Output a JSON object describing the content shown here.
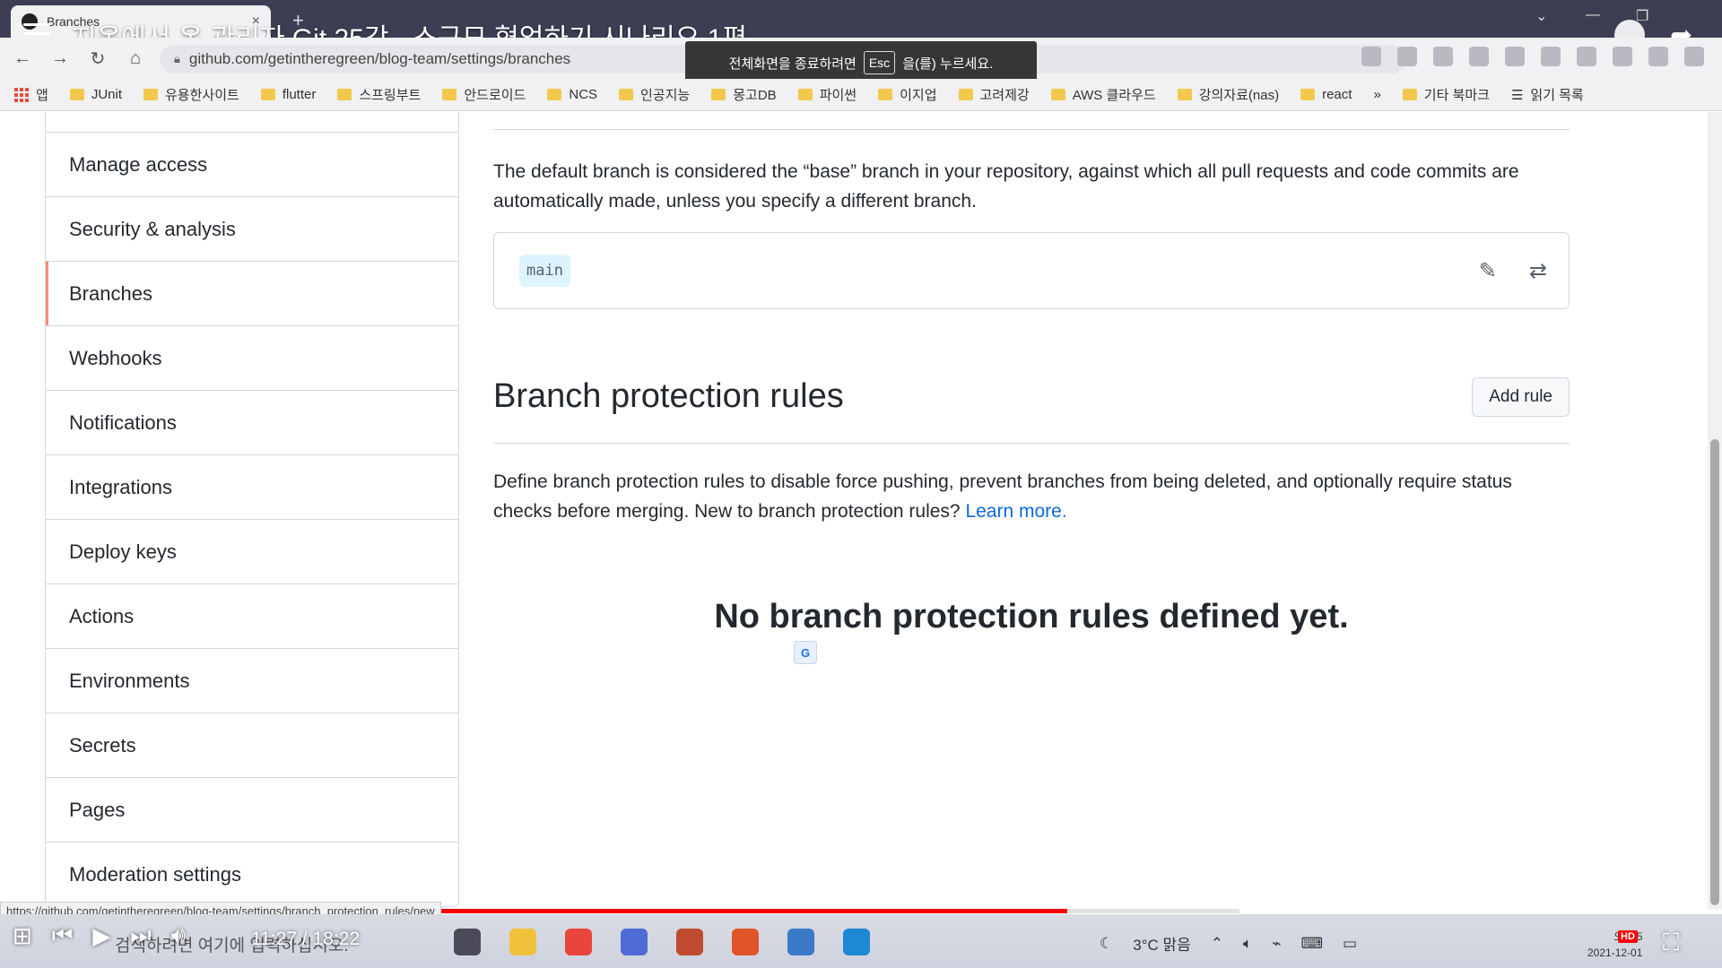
{
  "browser": {
    "tab_title": "Branches",
    "tab_close": "×",
    "new_tab": "+",
    "url": "github.com/getintheregreen/blog-team/settings/branches",
    "bookmarks": [
      "앱",
      "JUnit",
      "유용한사이트",
      "flutter",
      "스프링부트",
      "안드로이드",
      "NCS",
      "인공지능",
      "몽고DB",
      "파이썬",
      "이지업",
      "고려제강",
      "AWS 클라우드",
      "강의자료(nas)",
      "react"
    ],
    "bookmarks_more": "»",
    "other_bookmarks": "기타 북마크",
    "reading_list": "읽기 목록"
  },
  "video": {
    "title": "지옥에서 온 관리자 Git 25강 - 소규모 협업하기 시나리오 1편",
    "fullscreen_hint_pre": "전체화면을 종료하려면",
    "fullscreen_hint_key": "Esc",
    "fullscreen_hint_post": "을(를) 누르세요.",
    "time": "11:27 / 18:22",
    "progress_played": 0.62,
    "progress_loaded": 0.72,
    "hover_url": "https://github.com/getintheregreen/blog-team/settings/branch_protection_rules/new",
    "hd_badge": "HD"
  },
  "sidebar": {
    "items": [
      {
        "label": "Manage access"
      },
      {
        "label": "Security & analysis"
      },
      {
        "label": "Branches"
      },
      {
        "label": "Webhooks"
      },
      {
        "label": "Notifications"
      },
      {
        "label": "Integrations"
      },
      {
        "label": "Deploy keys"
      },
      {
        "label": "Actions"
      },
      {
        "label": "Environments"
      },
      {
        "label": "Secrets"
      },
      {
        "label": "Pages"
      },
      {
        "label": "Moderation settings"
      }
    ]
  },
  "default_branch": {
    "description": "The default branch is considered the “base” branch in your repository, against which all pull requests and code commits are automatically made, unless you specify a different branch.",
    "branch_name": "main"
  },
  "protection": {
    "title": "Branch protection rules",
    "add_rule_label": "Add rule",
    "description": "Define branch protection rules to disable force pushing, prevent branches from being deleted, and optionally require status checks before merging. New to branch protection rules?",
    "learn_more": "Learn more.",
    "empty_message": "No branch protection rules defined yet."
  },
  "taskbar": {
    "search_placeholder": "검색하려면 여기에 입력하십시오.",
    "weather": "3°C 맑음",
    "time": "오후 5",
    "date": "2021-12-01"
  }
}
